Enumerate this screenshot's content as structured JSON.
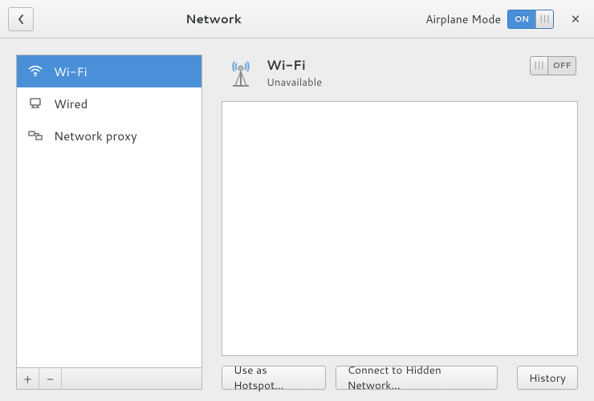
{
  "header": {
    "title": "Network",
    "airplane_label": "Airplane Mode",
    "airplane_state": "ON"
  },
  "sidebar": {
    "items": [
      {
        "icon": "wifi",
        "label": "Wi-Fi",
        "selected": true
      },
      {
        "icon": "wired",
        "label": "Wired",
        "selected": false
      },
      {
        "icon": "proxy",
        "label": "Network proxy",
        "selected": false
      }
    ],
    "add_label": "+",
    "remove_label": "−"
  },
  "main": {
    "title": "Wi-Fi",
    "subtitle": "Unavailable",
    "switch_state": "OFF",
    "buttons": {
      "hotspot": "Use as Hotspot...",
      "hidden": "Connect to Hidden Network...",
      "history": "History"
    }
  }
}
